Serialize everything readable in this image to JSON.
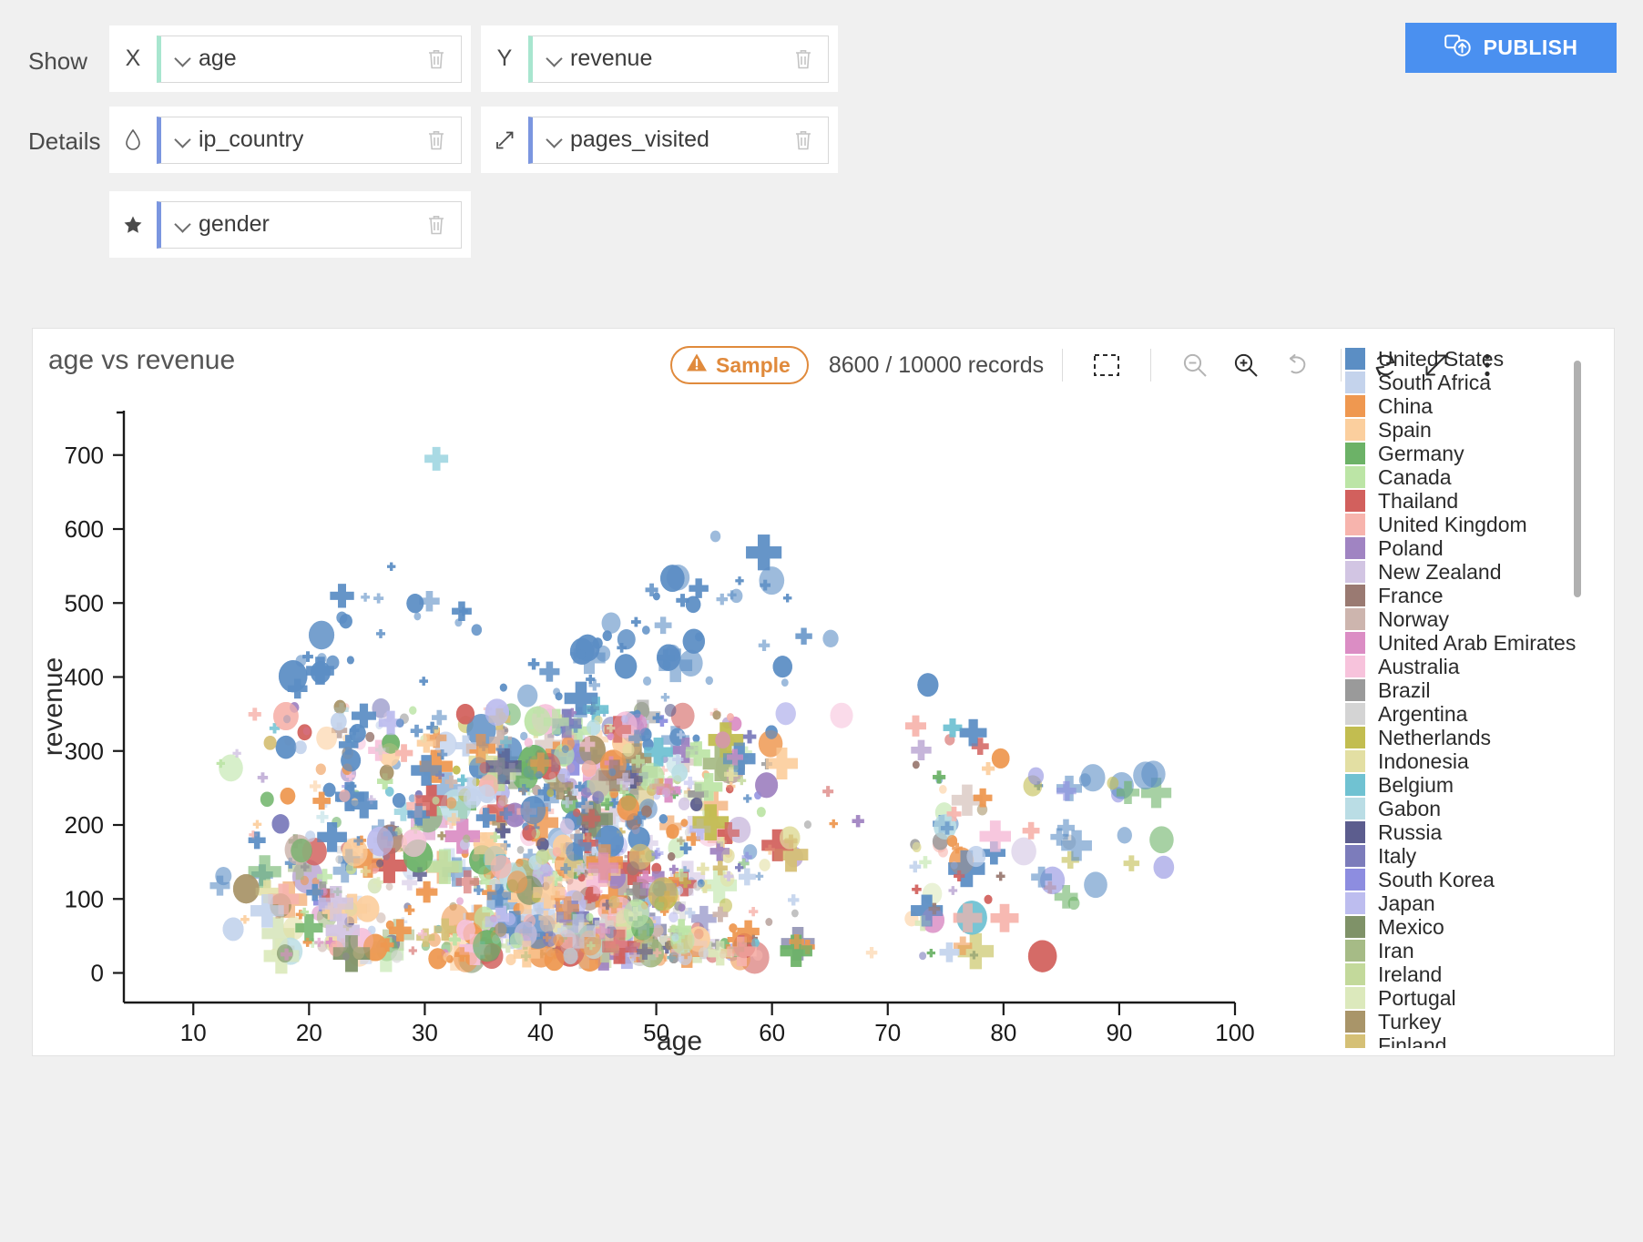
{
  "config": {
    "rows": [
      {
        "label": "Show"
      },
      {
        "label": "Details"
      }
    ],
    "pills": [
      {
        "channel": "X",
        "icon": "x-axis-icon",
        "field": "age",
        "accent": "#a8e6cf"
      },
      {
        "channel": "Y",
        "icon": "y-axis-icon",
        "field": "revenue",
        "accent": "#a8e6cf"
      },
      {
        "channel": "Color",
        "icon": "droplet-icon",
        "field": "ip_country",
        "accent": "#7b96e0"
      },
      {
        "channel": "Size",
        "icon": "resize-arrow-icon",
        "field": "pages_visited",
        "accent": "#7b96e0"
      },
      {
        "channel": "Shape",
        "icon": "star-icon",
        "field": "gender",
        "accent": "#7b96e0"
      }
    ],
    "delete_icon": "trash-icon"
  },
  "publish": {
    "label": "PUBLISH",
    "icon": "publish-upload-icon",
    "color": "#4a90f0"
  },
  "toolbar": {
    "sample_label": "Sample",
    "sample_icon": "warning-triangle-icon",
    "sample_color": "#e08a3c",
    "records": "8600 / 10000 records",
    "buttons": [
      {
        "name": "select-region-button",
        "icon": "dashed-rectangle-icon",
        "disabled": false
      },
      {
        "name": "zoom-out-button",
        "icon": "magnifier-minus-icon",
        "disabled": true
      },
      {
        "name": "zoom-in-button",
        "icon": "magnifier-plus-icon",
        "disabled": false
      },
      {
        "name": "undo-button",
        "icon": "undo-arrow-icon",
        "disabled": true
      },
      {
        "name": "refresh-button",
        "icon": "refresh-circular-icon",
        "disabled": false
      },
      {
        "name": "expand-button",
        "icon": "expand-diagonal-icon",
        "disabled": false
      },
      {
        "name": "more-options-button",
        "icon": "kebab-menu-icon",
        "disabled": false
      }
    ]
  },
  "chart_data": {
    "type": "scatter",
    "title": "age vs revenue",
    "xlabel": "age",
    "ylabel": "revenue",
    "xlim": [
      4,
      100
    ],
    "ylim": [
      -40,
      760
    ],
    "xticks": [
      10,
      20,
      30,
      40,
      50,
      60,
      70,
      80,
      90,
      100
    ],
    "yticks": [
      0,
      100,
      200,
      300,
      400,
      500,
      600,
      700
    ],
    "grid": false,
    "legend_position": "right",
    "color_field": "ip_country",
    "size_field": "pages_visited",
    "shape_field": "gender",
    "shapes": [
      "circle",
      "cross"
    ],
    "marker_opacity": 0.6,
    "n_points": 8600,
    "n_total": 10000,
    "legend": [
      {
        "label": "United States",
        "color": "#5b8ec4"
      },
      {
        "label": "South Africa",
        "color": "#c4d3ec"
      },
      {
        "label": "China",
        "color": "#ef9850"
      },
      {
        "label": "Spain",
        "color": "#fbcf9e"
      },
      {
        "label": "Germany",
        "color": "#6cb267"
      },
      {
        "label": "Canada",
        "color": "#bce5a6"
      },
      {
        "label": "Thailand",
        "color": "#d2605d"
      },
      {
        "label": "United Kingdom",
        "color": "#f7b4ad"
      },
      {
        "label": "Poland",
        "color": "#a084c2"
      },
      {
        "label": "New Zealand",
        "color": "#d2c5e3"
      },
      {
        "label": "France",
        "color": "#9a7a72"
      },
      {
        "label": "Norway",
        "color": "#cdb5ae"
      },
      {
        "label": "United Arab Emirates",
        "color": "#db8dc4"
      },
      {
        "label": "Australia",
        "color": "#f7c3dc"
      },
      {
        "label": "Brazil",
        "color": "#9a9a9a"
      },
      {
        "label": "Argentina",
        "color": "#d4d4d4"
      },
      {
        "label": "Netherlands",
        "color": "#c2bd50"
      },
      {
        "label": "Indonesia",
        "color": "#e3dfa3"
      },
      {
        "label": "Belgium",
        "color": "#70c2d2"
      },
      {
        "label": "Gabon",
        "color": "#badde5"
      },
      {
        "label": "Russia",
        "color": "#5c5d8e"
      },
      {
        "label": "Italy",
        "color": "#7c7cbb"
      },
      {
        "label": "South Korea",
        "color": "#8d8de0"
      },
      {
        "label": "Japan",
        "color": "#bdbdef"
      },
      {
        "label": "Mexico",
        "color": "#7f9268"
      },
      {
        "label": "Iran",
        "color": "#a6bb86"
      },
      {
        "label": "Ireland",
        "color": "#c3d99b"
      },
      {
        "label": "Portugal",
        "color": "#dce9bc"
      },
      {
        "label": "Turkey",
        "color": "#a99569"
      },
      {
        "label": "Finland",
        "color": "#d5c076"
      }
    ],
    "description": "Dense overplotted scatter of individual records; revenue concentrated 0-300 with a blue (United States) band rising to 400-570 between ages 25-70, one cyan outlier near age 31 at revenue 695. Point density thins sharply beyond age 80."
  }
}
